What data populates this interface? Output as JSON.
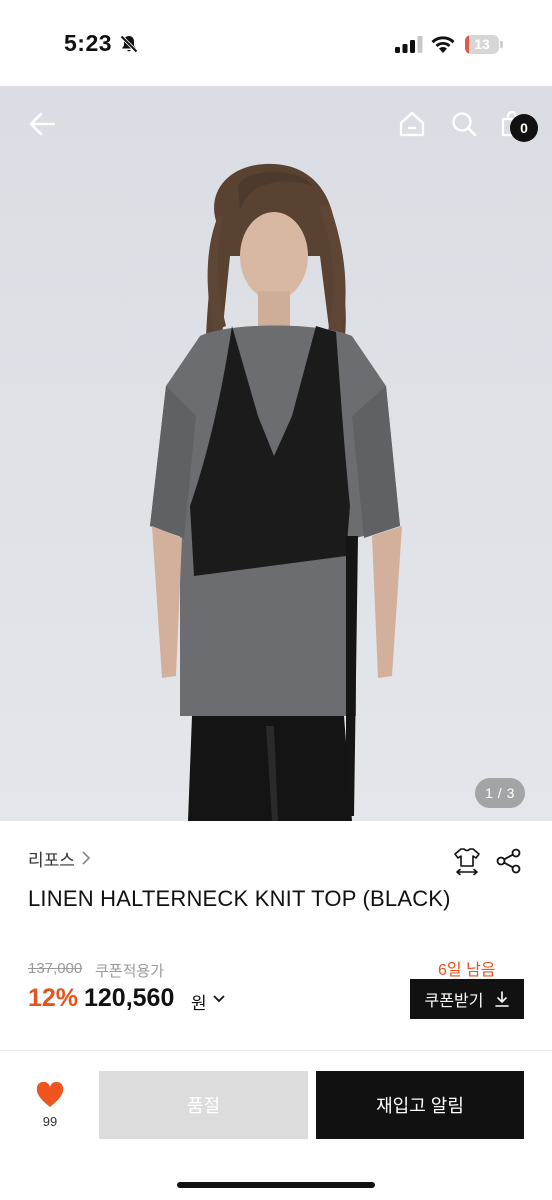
{
  "status_bar": {
    "time": "5:23",
    "battery_level": "13",
    "battery_fraction": 0.13,
    "battery_color": "#e05a45",
    "icons": [
      "bell-slash-icon",
      "signal-icon",
      "wifi-icon",
      "battery-icon"
    ]
  },
  "header": {
    "icons": [
      "back-arrow-icon",
      "home-icon",
      "search-icon",
      "shopping-bag-icon"
    ],
    "cart_count": "0"
  },
  "gallery": {
    "counter": "1 / 3"
  },
  "product": {
    "brand": "리포스",
    "name": "LINEN HALTERNECK KNIT TOP (BLACK)",
    "original_price": "137,000",
    "coupon_price_label": "쿠폰적용가",
    "discount": "12%",
    "sale_price": "120,560",
    "currency": "원",
    "days_left": "6일 남음",
    "coupon_button": "쿠폰받기",
    "accent_color": "#e8531d"
  },
  "bottom_bar": {
    "like_count": "99",
    "soldout_label": "품절",
    "restock_label": "재입고 알림"
  }
}
